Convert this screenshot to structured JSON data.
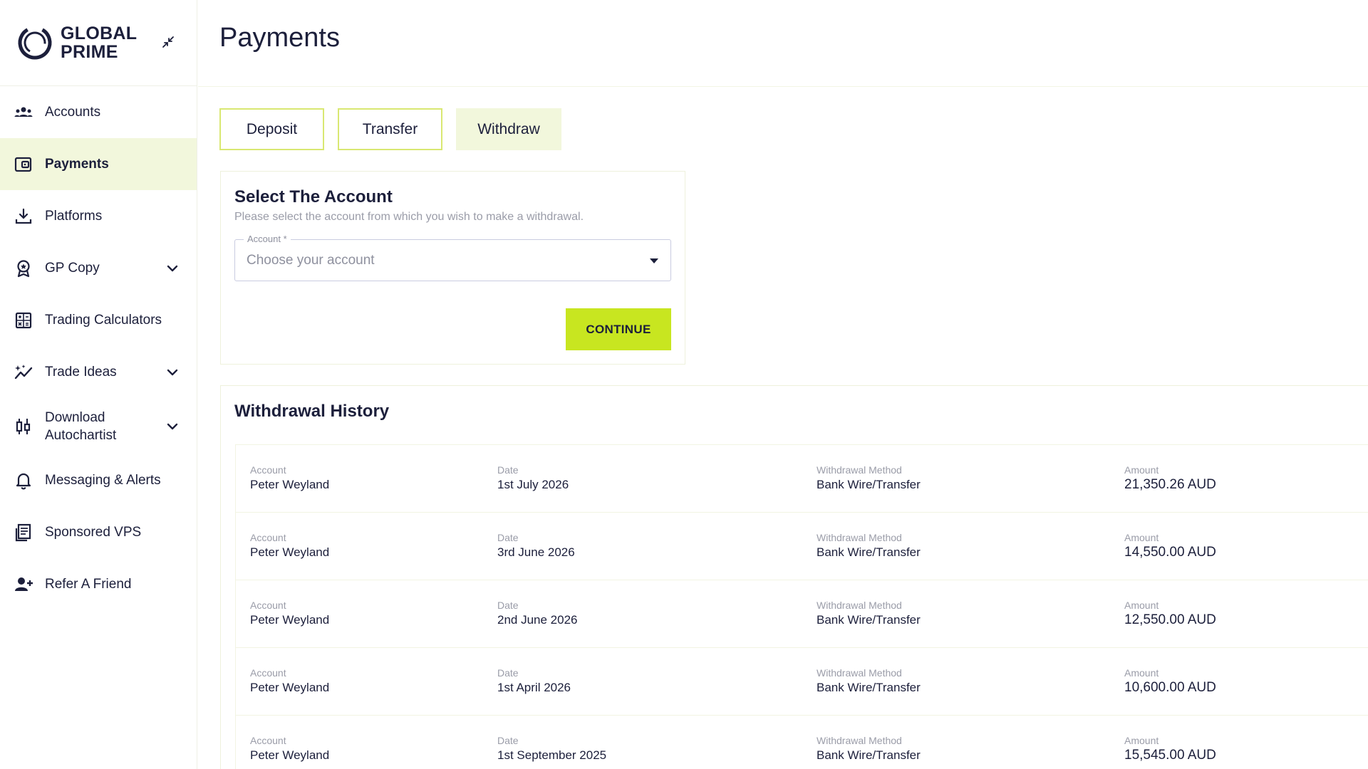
{
  "brand": {
    "line1": "GLOBAL",
    "line2": "PRIME"
  },
  "colors": {
    "accent": "#c8e620",
    "active_bg": "#f2f7dc",
    "tab_border": "#d9e872",
    "text": "#1c1f3b"
  },
  "sidebar": {
    "items": [
      {
        "label": "Accounts",
        "icon": "users-icon"
      },
      {
        "label": "Payments",
        "icon": "wallet-icon",
        "active": true
      },
      {
        "label": "Platforms",
        "icon": "download-icon"
      },
      {
        "label": "GP Copy",
        "icon": "award-icon",
        "has_chevron": true
      },
      {
        "label": "Trading Calculators",
        "icon": "calculator-icon"
      },
      {
        "label": "Trade Ideas",
        "icon": "sparkle-chart-icon",
        "has_chevron": true
      },
      {
        "label_line1": "Download",
        "label_line2": "Autochartist",
        "icon": "candlestick-icon",
        "has_chevron": true
      },
      {
        "label": "Messaging & Alerts",
        "icon": "bell-icon"
      },
      {
        "label": "Sponsored VPS",
        "icon": "server-icon"
      },
      {
        "label": "Refer A Friend",
        "icon": "user-plus-icon"
      }
    ]
  },
  "header": {
    "title": "Payments"
  },
  "tabs": [
    {
      "label": "Deposit"
    },
    {
      "label": "Transfer"
    },
    {
      "label": "Withdraw",
      "active": true
    }
  ],
  "select_account": {
    "title": "Select The Account",
    "subtitle": "Please select the account from which you wish to make a withdrawal.",
    "field_label": "Account *",
    "placeholder": "Choose your account",
    "continue_label": "CONTINUE"
  },
  "history": {
    "title": "Withdrawal History",
    "labels": {
      "account": "Account",
      "date": "Date",
      "method": "Withdrawal Method",
      "amount": "Amount"
    },
    "rows": [
      {
        "account": "Peter Weyland",
        "date": "1st July 2026",
        "method": "Bank Wire/Transfer",
        "amount": "21,350.26 AUD"
      },
      {
        "account": "Peter Weyland",
        "date": "3rd June 2026",
        "method": "Bank Wire/Transfer",
        "amount": "14,550.00 AUD"
      },
      {
        "account": "Peter Weyland",
        "date": "2nd June 2026",
        "method": "Bank Wire/Transfer",
        "amount": "12,550.00 AUD"
      },
      {
        "account": "Peter Weyland",
        "date": "1st April 2026",
        "method": "Bank Wire/Transfer",
        "amount": "10,600.00 AUD"
      },
      {
        "account": "Peter Weyland",
        "date": "1st September 2025",
        "method": "Bank Wire/Transfer",
        "amount": "15,545.00 AUD"
      }
    ]
  }
}
